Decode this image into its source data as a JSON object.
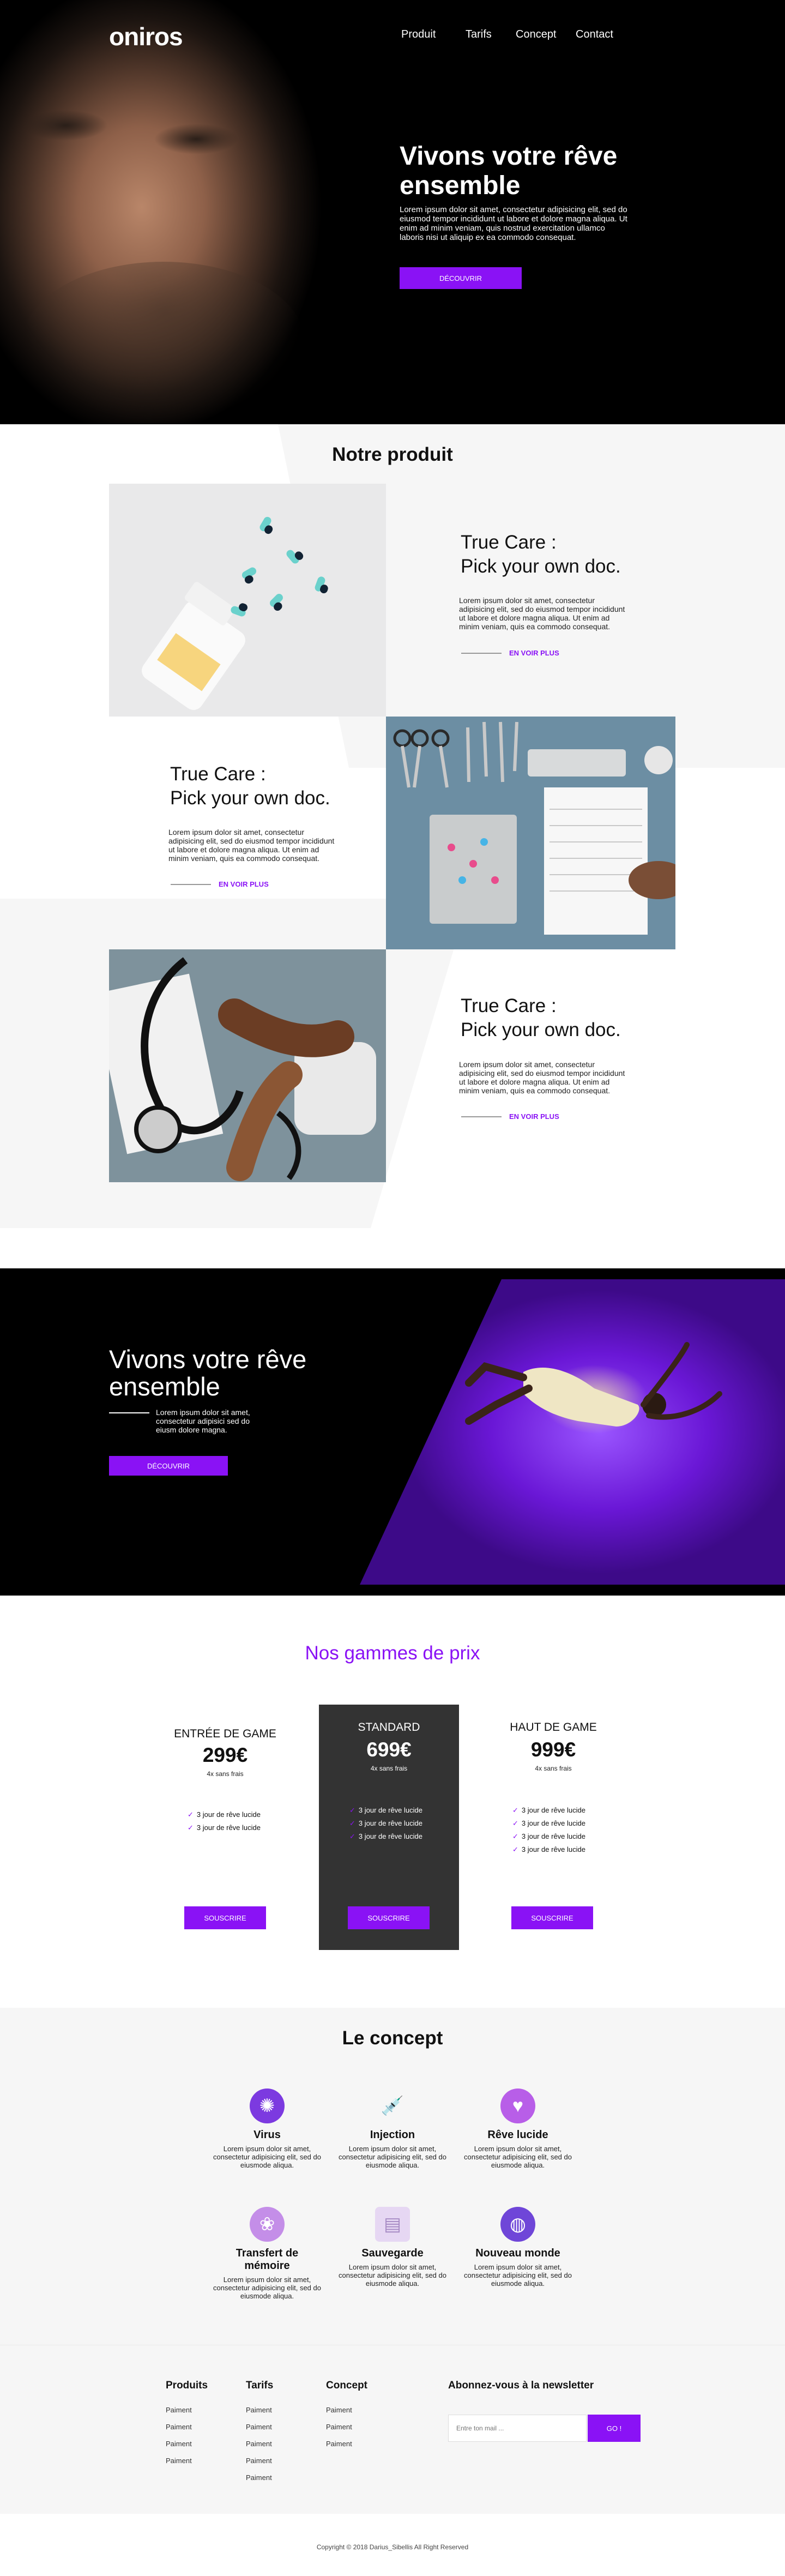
{
  "header": {
    "logo": "oniros",
    "nav": [
      "Produit",
      "Tarifs",
      "Concept",
      "Contact"
    ]
  },
  "hero": {
    "title": "Vivons votre rêve ensemble",
    "text": "Lorem ipsum dolor sit amet, consectetur adipisicing elit, sed do eiusmod tempor incididunt ut labore et dolore magna aliqua. Ut enim ad minim veniam, quis nostrud exercitation ullamco laboris nisi ut aliquip ex ea commodo consequat.",
    "button": "DÉCOUVRIR"
  },
  "product": {
    "title": "Notre produit",
    "items": [
      {
        "title_line1": "True Care :",
        "title_line2": "Pick your own doc.",
        "text": "Lorem ipsum dolor sit amet, consectetur adipisicing elit, sed do eiusmod tempor incididunt ut labore et dolore magna aliqua. Ut enim ad minim veniam, quis ea commodo consequat.",
        "link": "EN VOIR PLUS"
      },
      {
        "title_line1": "True Care :",
        "title_line2": "Pick your own doc.",
        "text": "Lorem ipsum dolor sit amet, consectetur adipisicing elit, sed do eiusmod tempor incididunt ut labore et dolore magna aliqua. Ut enim ad minim veniam, quis ea commodo consequat.",
        "link": "EN VOIR PLUS"
      },
      {
        "title_line1": "True Care :",
        "title_line2": "Pick your own doc.",
        "text": "Lorem ipsum dolor sit amet, consectetur adipisicing elit, sed do eiusmod tempor incididunt ut labore et dolore magna aliqua. Ut enim ad minim veniam, quis ea commodo consequat.",
        "link": "EN VOIR PLUS"
      }
    ]
  },
  "dream": {
    "title": "Vivons votre rêve ensemble",
    "text": "Lorem ipsum dolor sit amet, consectetur adipisici sed do eiusm dolore magna.",
    "button": "DÉCOUVRIR"
  },
  "pricing": {
    "title": "Nos gammes de prix",
    "plans": [
      {
        "name": "ENTRÉE DE GAME",
        "price": "299€",
        "sub": "4x sans frais",
        "features": [
          "3 jour de rêve lucide",
          "3 jour de rêve lucide"
        ],
        "button": "SOUSCRIRE"
      },
      {
        "name": "STANDARD",
        "price": "699€",
        "sub": "4x sans frais",
        "features": [
          "3 jour de rêve lucide",
          "3 jour de rêve lucide",
          "3 jour de rêve lucide"
        ],
        "button": "SOUSCRIRE"
      },
      {
        "name": "HAUT DE GAME",
        "price": "999€",
        "sub": "4x sans frais",
        "features": [
          "3 jour de rêve lucide",
          "3 jour de rêve lucide",
          "3 jour de rêve lucide",
          "3 jour de rêve lucide"
        ],
        "button": "SOUSCRIRE"
      }
    ]
  },
  "concept": {
    "title": "Le concept",
    "items": [
      {
        "name": "Virus",
        "icon": "virus-icon",
        "text": "Lorem ipsum dolor sit amet, consectetur adipisicing elit, sed do eiusmode aliqua."
      },
      {
        "name": "Injection",
        "icon": "syringe-icon",
        "text": "Lorem ipsum dolor sit amet, consectetur adipisicing elit, sed do eiusmode aliqua."
      },
      {
        "name": "Rêve lucide",
        "icon": "heartbeat-icon",
        "text": "Lorem ipsum dolor sit amet, consectetur adipisicing elit, sed do eiusmode aliqua."
      },
      {
        "name": "Transfert de mémoire",
        "icon": "brain-icon",
        "text": "Lorem ipsum dolor sit amet, consectetur adipisicing elit, sed do eiusmode aliqua."
      },
      {
        "name": "Sauvegarde",
        "icon": "save-icon",
        "text": "Lorem ipsum dolor sit amet, consectetur adipisicing elit, sed do eiusmode aliqua."
      },
      {
        "name": "Nouveau monde",
        "icon": "globe-icon",
        "text": "Lorem ipsum dolor sit amet, consectetur adipisicing elit, sed do eiusmode aliqua."
      }
    ]
  },
  "footer": {
    "columns": [
      {
        "title": "Produits",
        "links": [
          "Paiment",
          "Paiment",
          "Paiment",
          "Paiment"
        ]
      },
      {
        "title": "Tarifs",
        "links": [
          "Paiment",
          "Paiment",
          "Paiment",
          "Paiment",
          "Paiment"
        ]
      },
      {
        "title": "Concept",
        "links": [
          "Paiment",
          "Paiment",
          "Paiment"
        ]
      }
    ],
    "newsletter": {
      "title": "Abonnez-vous à la newsletter",
      "placeholder": "Entre ton mail ...",
      "button": "GO !"
    },
    "copyright": "Copyright © 2018 Darius_Sibellis All Right Reserved"
  },
  "colors": {
    "accent": "#8a12f5",
    "dark": "#333333",
    "light_grey": "#f6f6f6"
  }
}
